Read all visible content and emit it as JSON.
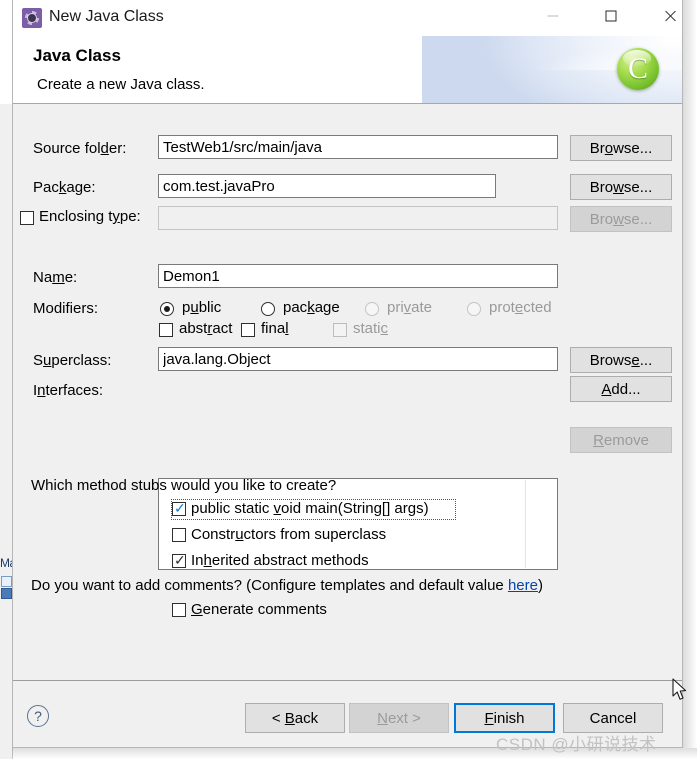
{
  "window": {
    "title": "New Java Class",
    "icon": "eclipse-wizard-icon",
    "controls": {
      "minimize": "—",
      "maximize": "□",
      "close": "✕"
    }
  },
  "header": {
    "title": "Java Class",
    "subtitle": "Create a new Java class.",
    "logo_letter": "C"
  },
  "form": {
    "source_folder": {
      "label_pre": "Source fol",
      "label_mn": "d",
      "label_post": "er:",
      "value": "TestWeb1/src/main/java",
      "browse_pre": "Br",
      "browse_mn": "o",
      "browse_post": "wse..."
    },
    "package": {
      "label_pre": "Pac",
      "label_mn": "k",
      "label_post": "age:",
      "value": "com.test.javaPro",
      "browse_pre": "Bro",
      "browse_mn": "w",
      "browse_post": "se..."
    },
    "enclosing_type": {
      "label_pre": "Enclosing t",
      "label_mn": "y",
      "label_post": "pe:",
      "value": "",
      "checked": false,
      "enabled": false,
      "browse_pre": "Bro",
      "browse_mn": "w",
      "browse_post": "se..."
    },
    "name": {
      "label_pre": "Na",
      "label_mn": "m",
      "label_post": "e:",
      "value": "Demon1"
    },
    "modifiers": {
      "label": "Modifiers:",
      "radios": [
        {
          "pre": "p",
          "mn": "u",
          "post": "blic",
          "selected": true,
          "enabled": true
        },
        {
          "pre": "pac",
          "mn": "k",
          "post": "age",
          "selected": false,
          "enabled": true
        },
        {
          "pre": "pri",
          "mn": "v",
          "post": "ate",
          "selected": false,
          "enabled": false
        },
        {
          "pre": "prot",
          "mn": "e",
          "post": "cted",
          "selected": false,
          "enabled": false
        }
      ],
      "checks": [
        {
          "pre": "abst",
          "mn": "r",
          "post": "act",
          "checked": false,
          "enabled": true
        },
        {
          "pre": "fina",
          "mn": "l",
          "post": "",
          "checked": false,
          "enabled": true
        },
        {
          "pre": "stati",
          "mn": "c",
          "post": "",
          "checked": false,
          "enabled": false
        }
      ]
    },
    "superclass": {
      "label_pre": "S",
      "label_mn": "u",
      "label_post": "perclass:",
      "value": "java.lang.Object",
      "browse_pre": "Brows",
      "browse_mn": "e",
      "browse_post": "..."
    },
    "interfaces": {
      "label_pre": "I",
      "label_mn": "n",
      "label_post": "terfaces:",
      "items": [],
      "add_pre": "",
      "add_mn": "A",
      "add_post": "dd...",
      "remove_pre": "",
      "remove_mn": "R",
      "remove_post": "emove",
      "remove_enabled": false
    },
    "stubs": {
      "question": "Which method stubs would you like to create?",
      "items": [
        {
          "pre": "public static ",
          "mn": "v",
          "post": "oid main(String[] args)",
          "checked": true,
          "focused": true,
          "tick_color": "blue"
        },
        {
          "pre": "Constr",
          "mn": "u",
          "post": "ctors from superclass",
          "checked": false,
          "focused": false,
          "tick_color": "dark"
        },
        {
          "pre": "In",
          "mn": "h",
          "post": "erited abstract methods",
          "checked": true,
          "focused": false,
          "tick_color": "dark"
        }
      ]
    },
    "comments": {
      "question_pre": "Do you want to add comments? (Configure templates and default value ",
      "link": "here",
      "question_post": ")",
      "checkbox": {
        "pre": "",
        "mn": "G",
        "post": "enerate comments",
        "checked": false
      }
    }
  },
  "footer": {
    "help_glyph": "?",
    "buttons": [
      {
        "pre": "< ",
        "mn": "B",
        "post": "ack",
        "enabled": true,
        "default": false
      },
      {
        "pre": "",
        "mn": "N",
        "post": "ext >",
        "enabled": false,
        "default": false
      },
      {
        "pre": "",
        "mn": "F",
        "post": "inish",
        "enabled": true,
        "default": true
      },
      {
        "pre": "Cancel",
        "mn": "",
        "post": "",
        "enabled": true,
        "default": false
      }
    ]
  },
  "watermark": "CSDN @小研说技术",
  "ide_background": {
    "tab_label": "Ma"
  },
  "colors": {
    "accent": "#0078d7",
    "link": "#0645ad",
    "dialog_bg": "#f0f0f0",
    "logo_green": "#74bf2b",
    "icon_purple": "#7b5ea7"
  }
}
